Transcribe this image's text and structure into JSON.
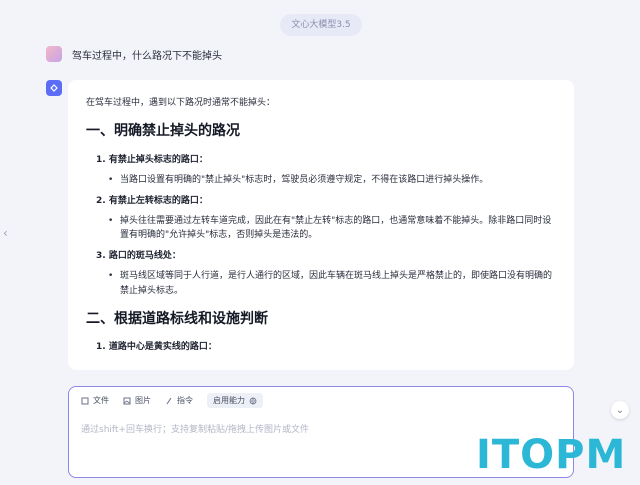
{
  "header": {
    "model_label": "文心大模型3.5"
  },
  "user_message": {
    "text": "驾车过程中，什么路况下不能掉头"
  },
  "answer": {
    "intro": "在驾车过程中，遇到以下路况时通常不能掉头：",
    "section1_title": "一、明确禁止掉头的路况",
    "items": [
      {
        "title": "1. 有禁止掉头标志的路口：",
        "bullet": "当路口设置有明确的\"禁止掉头\"标志时，驾驶员必须遵守规定，不得在该路口进行掉头操作。"
      },
      {
        "title": "2. 有禁止左转标志的路口：",
        "bullet": "掉头往往需要通过左转车道完成，因此在有\"禁止左转\"标志的路口，也通常意味着不能掉头。除非路口同时设置有明确的\"允许掉头\"标志，否则掉头是违法的。"
      },
      {
        "title": "3. 路口的斑马线处：",
        "bullet": "斑马线区域等同于人行道，是行人通行的区域，因此车辆在斑马线上掉头是严格禁止的，即使路口没有明确的禁止掉头标志。"
      }
    ],
    "section2_title": "二、根据道路标线和设施判断",
    "section2_item1": "1. 道路中心是黄实线的路口："
  },
  "input": {
    "tools": [
      {
        "label": "文件",
        "icon": "file-icon"
      },
      {
        "label": "图片",
        "icon": "image-icon"
      },
      {
        "label": "指令",
        "icon": "command-icon"
      },
      {
        "label": "启用能力",
        "icon": "globe-icon"
      }
    ],
    "placeholder": "通过shift+回车换行；支持复制粘贴/拖拽上传图片或文件"
  },
  "brand": {
    "logo_text": "ITOPM"
  }
}
